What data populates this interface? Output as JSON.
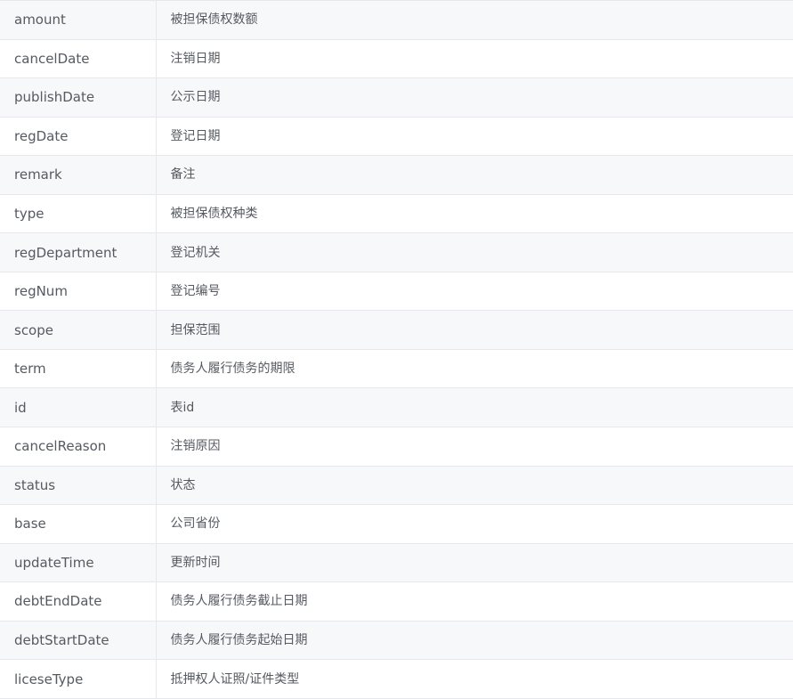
{
  "rows": [
    {
      "name": "amount",
      "description": "被担保债权数额"
    },
    {
      "name": "cancelDate",
      "description": "注销日期"
    },
    {
      "name": "publishDate",
      "description": "公示日期"
    },
    {
      "name": "regDate",
      "description": "登记日期"
    },
    {
      "name": "remark",
      "description": "备注"
    },
    {
      "name": "type",
      "description": "被担保债权种类"
    },
    {
      "name": "regDepartment",
      "description": "登记机关"
    },
    {
      "name": "regNum",
      "description": "登记编号"
    },
    {
      "name": "scope",
      "description": "担保范围"
    },
    {
      "name": "term",
      "description": "债务人履行债务的期限"
    },
    {
      "name": "id",
      "description": "表id"
    },
    {
      "name": "cancelReason",
      "description": "注销原因"
    },
    {
      "name": "status",
      "description": "状态"
    },
    {
      "name": "base",
      "description": "公司省份"
    },
    {
      "name": "updateTime",
      "description": "更新时间"
    },
    {
      "name": "debtEndDate",
      "description": "债务人履行债务截止日期"
    },
    {
      "name": "debtStartDate",
      "description": "债务人履行债务起始日期"
    },
    {
      "name": "liceseType",
      "description": "抵押权人证照/证件类型"
    }
  ]
}
